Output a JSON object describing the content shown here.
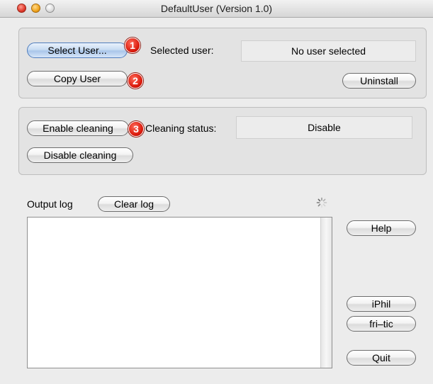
{
  "window": {
    "title": "DefaultUser (Version 1.0)"
  },
  "user_group": {
    "select_user_label": "Select User...",
    "copy_user_label": "Copy User",
    "uninstall_label": "Uninstall",
    "selected_user_label": "Selected user:",
    "selected_user_value": "No user selected",
    "badge_select": "1",
    "badge_copy": "2"
  },
  "cleaning_group": {
    "enable_label": "Enable cleaning",
    "disable_label": "Disable cleaning",
    "status_label": "Cleaning status:",
    "status_value": "Disable",
    "badge_enable": "3"
  },
  "output": {
    "label": "Output log",
    "clear_label": "Clear log",
    "log_text": ""
  },
  "side_buttons": {
    "help_label": "Help",
    "iphil_label": "iPhil",
    "fritic_label": "fri–tic",
    "quit_label": "Quit"
  },
  "colors": {
    "badge_red": "#d9180a",
    "default_button_blue": "#a9c6ea"
  },
  "icons": {
    "spinner": "progress-spinner-icon",
    "close": "close-icon",
    "minimize": "minimize-icon",
    "zoom": "zoom-icon"
  }
}
